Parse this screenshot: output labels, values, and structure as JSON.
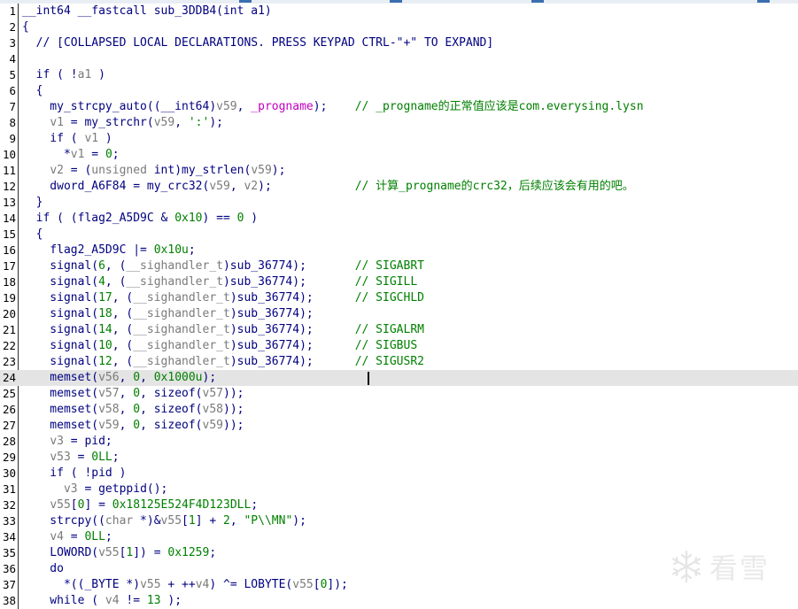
{
  "window": {
    "top_strip_color": "#3b6fb0"
  },
  "editor": {
    "current_line": 24,
    "lines": [
      {
        "n": "1",
        "parts": [
          [
            "t",
            "__int64 __fastcall sub_3DDB4(int a1)"
          ]
        ]
      },
      {
        "n": "2",
        "parts": [
          [
            "t",
            "{"
          ]
        ]
      },
      {
        "n": "3",
        "parts": [
          [
            "t",
            "  // [COLLAPSED LOCAL DECLARATIONS. PRESS KEYPAD CTRL-\"+\" TO EXPAND]"
          ]
        ]
      },
      {
        "n": "4",
        "parts": []
      },
      {
        "n": "5",
        "parts": [
          [
            "t",
            "  if ( !"
          ],
          [
            "lv",
            "a1"
          ],
          [
            "t",
            " )"
          ]
        ]
      },
      {
        "n": "6",
        "parts": [
          [
            "t",
            "  {"
          ]
        ]
      },
      {
        "n": "7",
        "parts": [
          [
            "t",
            "    my_strcpy_auto((__int64)"
          ],
          [
            "lv",
            "v59"
          ],
          [
            "t",
            ", "
          ],
          [
            "gl",
            "_progname"
          ],
          [
            "t",
            ");    "
          ],
          [
            "cm",
            "// _progname的正常值应该是com.everysing.lysn"
          ]
        ]
      },
      {
        "n": "8",
        "parts": [
          [
            "t",
            "    "
          ],
          [
            "lv",
            "v1"
          ],
          [
            "t",
            " = my_strchr("
          ],
          [
            "lv",
            "v59"
          ],
          [
            "t",
            ", "
          ],
          [
            "str",
            "':'"
          ],
          [
            "t",
            ");"
          ]
        ]
      },
      {
        "n": "9",
        "parts": [
          [
            "t",
            "    if ( "
          ],
          [
            "lv",
            "v1"
          ],
          [
            "t",
            " )"
          ]
        ]
      },
      {
        "n": "10",
        "parts": [
          [
            "t",
            "      *"
          ],
          [
            "lv",
            "v1"
          ],
          [
            "t",
            " = "
          ],
          [
            "num",
            "0"
          ],
          [
            "t",
            ";"
          ]
        ]
      },
      {
        "n": "11",
        "parts": [
          [
            "t",
            "    "
          ],
          [
            "lv",
            "v2"
          ],
          [
            "t",
            " = ("
          ],
          [
            "lv",
            "unsigned"
          ],
          [
            "t",
            " int)my_strlen("
          ],
          [
            "lv",
            "v59"
          ],
          [
            "t",
            ");"
          ]
        ]
      },
      {
        "n": "12",
        "parts": [
          [
            "t",
            "    dword_A6F84 = my_crc32("
          ],
          [
            "lv",
            "v59"
          ],
          [
            "t",
            ", "
          ],
          [
            "lv",
            "v2"
          ],
          [
            "t",
            ");            "
          ],
          [
            "cm",
            "// 计算_progname的crc32，后续应该会有用的吧。"
          ]
        ]
      },
      {
        "n": "13",
        "parts": [
          [
            "t",
            "  }"
          ]
        ]
      },
      {
        "n": "14",
        "parts": [
          [
            "t",
            "  if ( (flag2_A5D9C & "
          ],
          [
            "num",
            "0x10"
          ],
          [
            "t",
            ") == "
          ],
          [
            "num",
            "0"
          ],
          [
            "t",
            " )"
          ]
        ]
      },
      {
        "n": "15",
        "parts": [
          [
            "t",
            "  {"
          ]
        ]
      },
      {
        "n": "16",
        "parts": [
          [
            "t",
            "    flag2_A5D9C |= "
          ],
          [
            "num",
            "0x10u"
          ],
          [
            "t",
            ";"
          ]
        ]
      },
      {
        "n": "17",
        "parts": [
          [
            "t",
            "    signal("
          ],
          [
            "num",
            "6"
          ],
          [
            "t",
            ", ("
          ],
          [
            "lv",
            "__sighandler_t"
          ],
          [
            "t",
            ")sub_36774);       "
          ],
          [
            "cm",
            "// SIGABRT"
          ]
        ]
      },
      {
        "n": "18",
        "parts": [
          [
            "t",
            "    signal("
          ],
          [
            "num",
            "4"
          ],
          [
            "t",
            ", ("
          ],
          [
            "lv",
            "__sighandler_t"
          ],
          [
            "t",
            ")sub_36774);       "
          ],
          [
            "cm",
            "// SIGILL"
          ]
        ]
      },
      {
        "n": "19",
        "parts": [
          [
            "t",
            "    signal("
          ],
          [
            "num",
            "17"
          ],
          [
            "t",
            ", ("
          ],
          [
            "lv",
            "__sighandler_t"
          ],
          [
            "t",
            ")sub_36774);      "
          ],
          [
            "cm",
            "// SIGCHLD"
          ]
        ]
      },
      {
        "n": "20",
        "parts": [
          [
            "t",
            "    signal("
          ],
          [
            "num",
            "18"
          ],
          [
            "t",
            ", ("
          ],
          [
            "lv",
            "__sighandler_t"
          ],
          [
            "t",
            ")sub_36774);"
          ]
        ]
      },
      {
        "n": "21",
        "parts": [
          [
            "t",
            "    signal("
          ],
          [
            "num",
            "14"
          ],
          [
            "t",
            ", ("
          ],
          [
            "lv",
            "__sighandler_t"
          ],
          [
            "t",
            ")sub_36774);      "
          ],
          [
            "cm",
            "// SIGALRM"
          ]
        ]
      },
      {
        "n": "22",
        "parts": [
          [
            "t",
            "    signal("
          ],
          [
            "num",
            "10"
          ],
          [
            "t",
            ", ("
          ],
          [
            "lv",
            "__sighandler_t"
          ],
          [
            "t",
            ")sub_36774);      "
          ],
          [
            "cm",
            "// SIGBUS"
          ]
        ]
      },
      {
        "n": "23",
        "parts": [
          [
            "t",
            "    signal("
          ],
          [
            "num",
            "12"
          ],
          [
            "t",
            ", ("
          ],
          [
            "lv",
            "__sighandler_t"
          ],
          [
            "t",
            ")sub_36774);      "
          ],
          [
            "cm",
            "// SIGUSR2"
          ]
        ]
      },
      {
        "n": "24",
        "parts": [
          [
            "t",
            "    memset("
          ],
          [
            "lv",
            "v56"
          ],
          [
            "t",
            ", "
          ],
          [
            "num",
            "0"
          ],
          [
            "t",
            ", "
          ],
          [
            "num",
            "0x1000u"
          ],
          [
            "t",
            ");"
          ]
        ]
      },
      {
        "n": "25",
        "parts": [
          [
            "t",
            "    memset("
          ],
          [
            "lv",
            "v57"
          ],
          [
            "t",
            ", "
          ],
          [
            "num",
            "0"
          ],
          [
            "t",
            ", sizeof("
          ],
          [
            "lv",
            "v57"
          ],
          [
            "t",
            "));"
          ]
        ]
      },
      {
        "n": "26",
        "parts": [
          [
            "t",
            "    memset("
          ],
          [
            "lv",
            "v58"
          ],
          [
            "t",
            ", "
          ],
          [
            "num",
            "0"
          ],
          [
            "t",
            ", sizeof("
          ],
          [
            "lv",
            "v58"
          ],
          [
            "t",
            "));"
          ]
        ]
      },
      {
        "n": "27",
        "parts": [
          [
            "t",
            "    memset("
          ],
          [
            "lv",
            "v59"
          ],
          [
            "t",
            ", "
          ],
          [
            "num",
            "0"
          ],
          [
            "t",
            ", sizeof("
          ],
          [
            "lv",
            "v59"
          ],
          [
            "t",
            "));"
          ]
        ]
      },
      {
        "n": "28",
        "parts": [
          [
            "t",
            "    "
          ],
          [
            "lv",
            "v3"
          ],
          [
            "t",
            " = pid;"
          ]
        ]
      },
      {
        "n": "29",
        "parts": [
          [
            "t",
            "    "
          ],
          [
            "lv",
            "v53"
          ],
          [
            "t",
            " = "
          ],
          [
            "num",
            "0LL"
          ],
          [
            "t",
            ";"
          ]
        ]
      },
      {
        "n": "30",
        "parts": [
          [
            "t",
            "    if ( !pid )"
          ]
        ]
      },
      {
        "n": "31",
        "parts": [
          [
            "t",
            "      "
          ],
          [
            "lv",
            "v3"
          ],
          [
            "t",
            " = getppid();"
          ]
        ]
      },
      {
        "n": "32",
        "parts": [
          [
            "t",
            "    "
          ],
          [
            "lv",
            "v55"
          ],
          [
            "t",
            "["
          ],
          [
            "num",
            "0"
          ],
          [
            "t",
            "] = "
          ],
          [
            "num",
            "0x18125E524F4D123DLL"
          ],
          [
            "t",
            ";"
          ]
        ]
      },
      {
        "n": "33",
        "parts": [
          [
            "t",
            "    strcpy(("
          ],
          [
            "lv",
            "char"
          ],
          [
            "t",
            " *)&"
          ],
          [
            "lv",
            "v55"
          ],
          [
            "t",
            "["
          ],
          [
            "num",
            "1"
          ],
          [
            "t",
            "] + "
          ],
          [
            "num",
            "2"
          ],
          [
            "t",
            ", "
          ],
          [
            "str",
            "\"P\\\\MN\""
          ],
          [
            "t",
            ");"
          ]
        ]
      },
      {
        "n": "34",
        "parts": [
          [
            "t",
            "    "
          ],
          [
            "lv",
            "v4"
          ],
          [
            "t",
            " = "
          ],
          [
            "num",
            "0LL"
          ],
          [
            "t",
            ";"
          ]
        ]
      },
      {
        "n": "35",
        "parts": [
          [
            "t",
            "    LOWORD("
          ],
          [
            "lv",
            "v55"
          ],
          [
            "t",
            "["
          ],
          [
            "num",
            "1"
          ],
          [
            "t",
            "]) = "
          ],
          [
            "num",
            "0x1259"
          ],
          [
            "t",
            ";"
          ]
        ]
      },
      {
        "n": "36",
        "parts": [
          [
            "t",
            "    do"
          ]
        ]
      },
      {
        "n": "37",
        "parts": [
          [
            "t",
            "      *((_BYTE *)"
          ],
          [
            "lv",
            "v55"
          ],
          [
            "t",
            " + ++"
          ],
          [
            "lv",
            "v4"
          ],
          [
            "t",
            ") ^= LOBYTE("
          ],
          [
            "lv",
            "v55"
          ],
          [
            "t",
            "["
          ],
          [
            "num",
            "0"
          ],
          [
            "t",
            "]);"
          ]
        ]
      },
      {
        "n": "38",
        "parts": [
          [
            "t",
            "    while ( "
          ],
          [
            "lv",
            "v4"
          ],
          [
            "t",
            " != "
          ],
          [
            "num",
            "13"
          ],
          [
            "t",
            " );"
          ]
        ]
      }
    ]
  },
  "watermark": {
    "text": "看雪",
    "icon": "snowflake-icon"
  }
}
